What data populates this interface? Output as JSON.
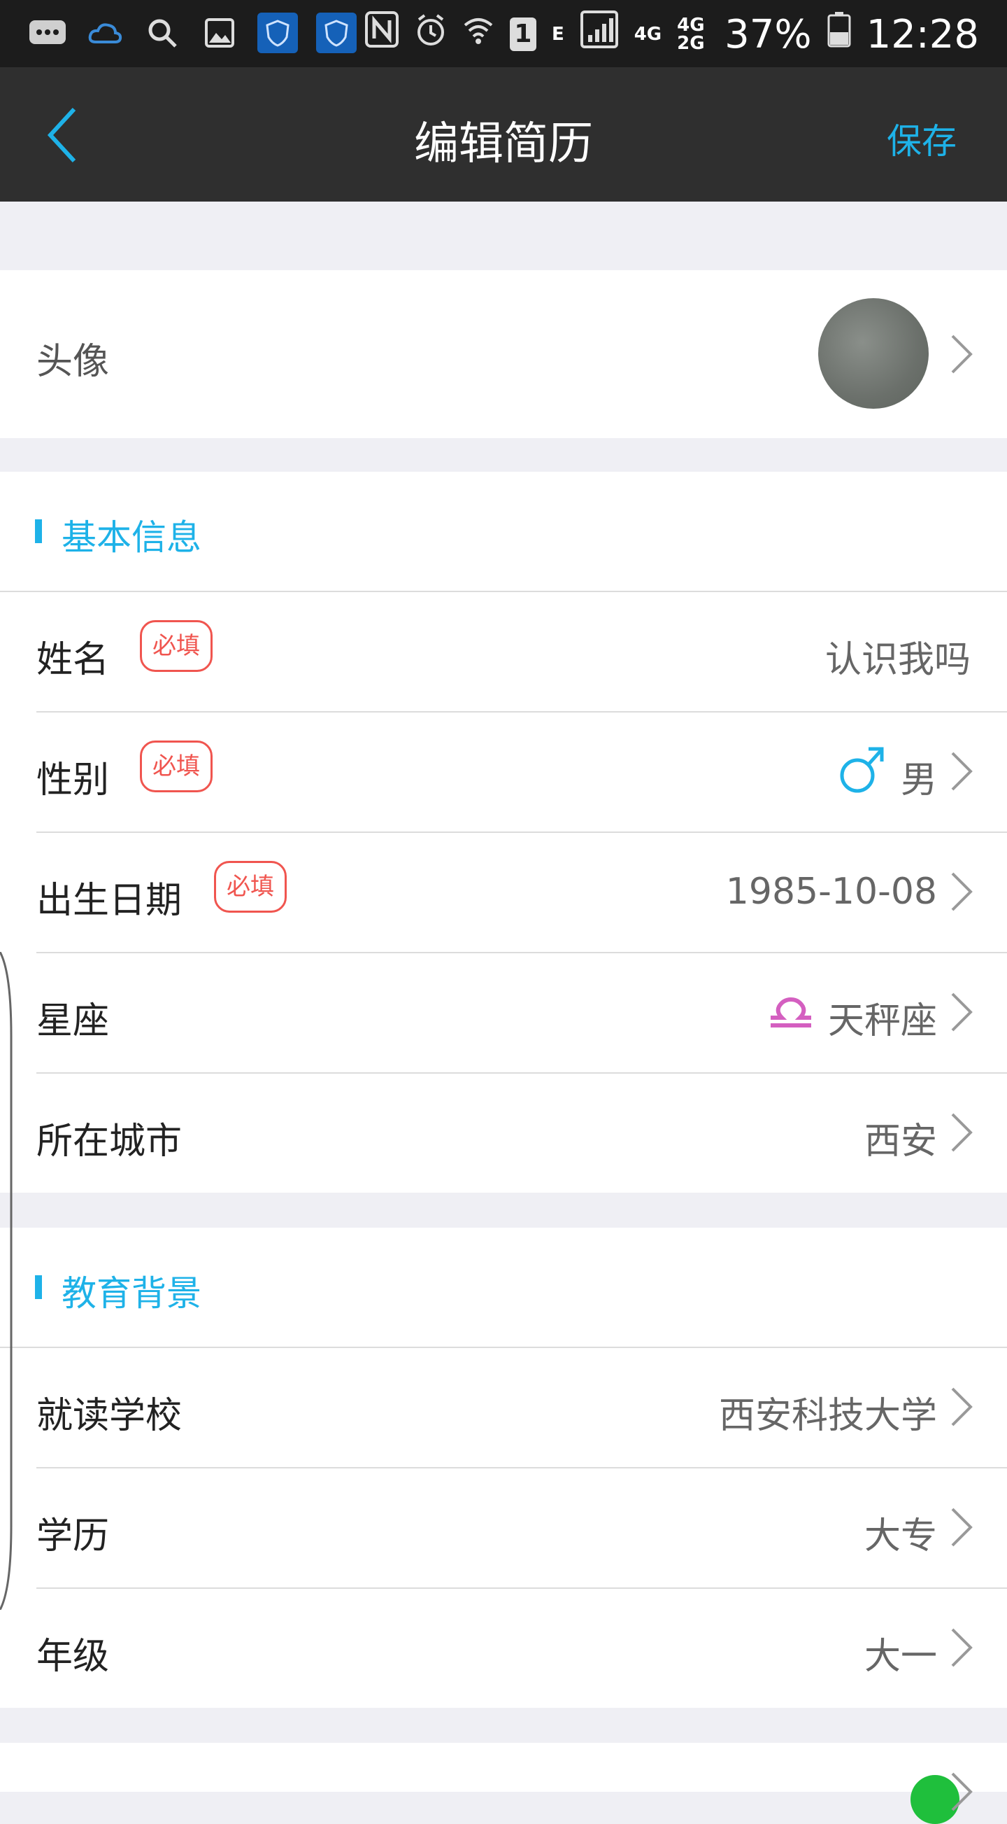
{
  "status_bar": {
    "battery": "37%",
    "time": "12:28",
    "network_e": "E",
    "network_4g": "4G",
    "network_4g2g": "4G 2G",
    "sim": "1"
  },
  "nav": {
    "title": "编辑简历",
    "save_label": "保存"
  },
  "avatar_row": {
    "label": "头像"
  },
  "basic_info": {
    "header": "基本信息",
    "required_badge": "必填",
    "name_label": "姓名",
    "name_value": "认识我吗",
    "gender_label": "性别",
    "gender_value": "男",
    "birth_label": "出生日期",
    "birth_value": "1985-10-08",
    "zodiac_label": "星座",
    "zodiac_value": "天秤座",
    "city_label": "所在城市",
    "city_value": "西安"
  },
  "education": {
    "header": "教育背景",
    "school_label": "就读学校",
    "school_value": "西安科技大学",
    "degree_label": "学历",
    "degree_value": "大专",
    "grade_label": "年级",
    "grade_value": "大一"
  },
  "colors": {
    "accent": "#1eb2e8",
    "required": "#f0554f",
    "zodiac_icon": "#d45fc0",
    "nav_bg": "#2f2f2f"
  }
}
